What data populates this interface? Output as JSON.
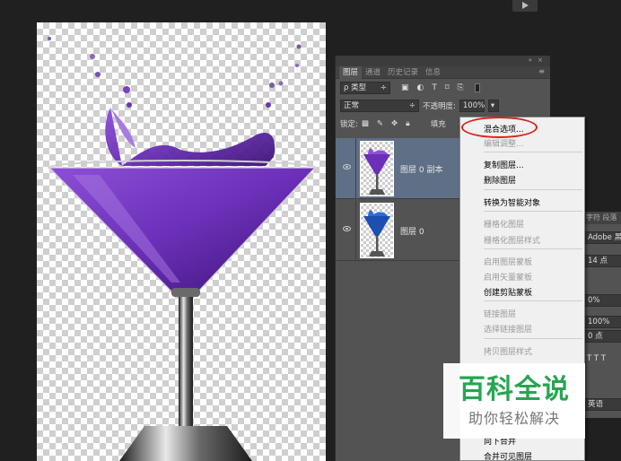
{
  "canvas": {
    "alt": "martini glass with purple liquid splash on transparent background"
  },
  "layers_panel": {
    "top_controls": "«  ×",
    "tabs": [
      "图层",
      "通道",
      "历史记录",
      "信息"
    ],
    "menu_icon": "≡",
    "filter": {
      "kind": "ρ 类型",
      "arrow": "÷"
    },
    "filter_icons": [
      "image-filter-icon",
      "adjustment-filter-icon",
      "type-filter-icon",
      "shape-filter-icon",
      "smartobject-filter-icon"
    ],
    "blend_mode": "正常",
    "blend_arrow": "÷",
    "opacity_label": "不透明度:",
    "opacity_value": "100%",
    "lock_label": "锁定:",
    "fill_label": "填充",
    "layers": [
      {
        "name": "图层 0 副本",
        "selected": true
      },
      {
        "name": "图层 0",
        "selected": false
      }
    ]
  },
  "character_panel": {
    "tabs": "字符  段落",
    "font": "Adobe 黑体",
    "size": "14 点",
    "tracking": "0%",
    "scale": "100%",
    "baseline": "0 点",
    "styles": "T T T",
    "lang": "英语"
  },
  "context_menu": {
    "items": [
      {
        "label": "混合选项...",
        "disabled": false
      },
      {
        "label": "编辑调整...",
        "disabled": true
      },
      {
        "label": "复制图层...",
        "disabled": false
      },
      {
        "label": "删除图层",
        "disabled": false
      },
      {
        "label": "转换为智能对象",
        "disabled": false
      },
      {
        "label": "栅格化图层",
        "disabled": true
      },
      {
        "label": "栅格化图层样式",
        "disabled": true
      },
      {
        "label": "启用图层蒙板",
        "disabled": true
      },
      {
        "label": "启用矢量蒙板",
        "disabled": true
      },
      {
        "label": "创建剪贴蒙板",
        "disabled": false
      },
      {
        "label": "链接图层",
        "disabled": true
      },
      {
        "label": "选择链接图层",
        "disabled": true
      },
      {
        "label": "拷贝图层样式",
        "disabled": true
      },
      {
        "label": "向下合并",
        "disabled": false
      },
      {
        "label": "合并可见图层",
        "disabled": false
      }
    ]
  },
  "watermark": {
    "title": "百科全说",
    "subtitle": "助你轻松解决"
  },
  "colors": {
    "selected_layer": "#5e6f86",
    "panel_bg": "#535353",
    "highlight_circle": "#d8231f",
    "watermark_green": "#27a551"
  }
}
